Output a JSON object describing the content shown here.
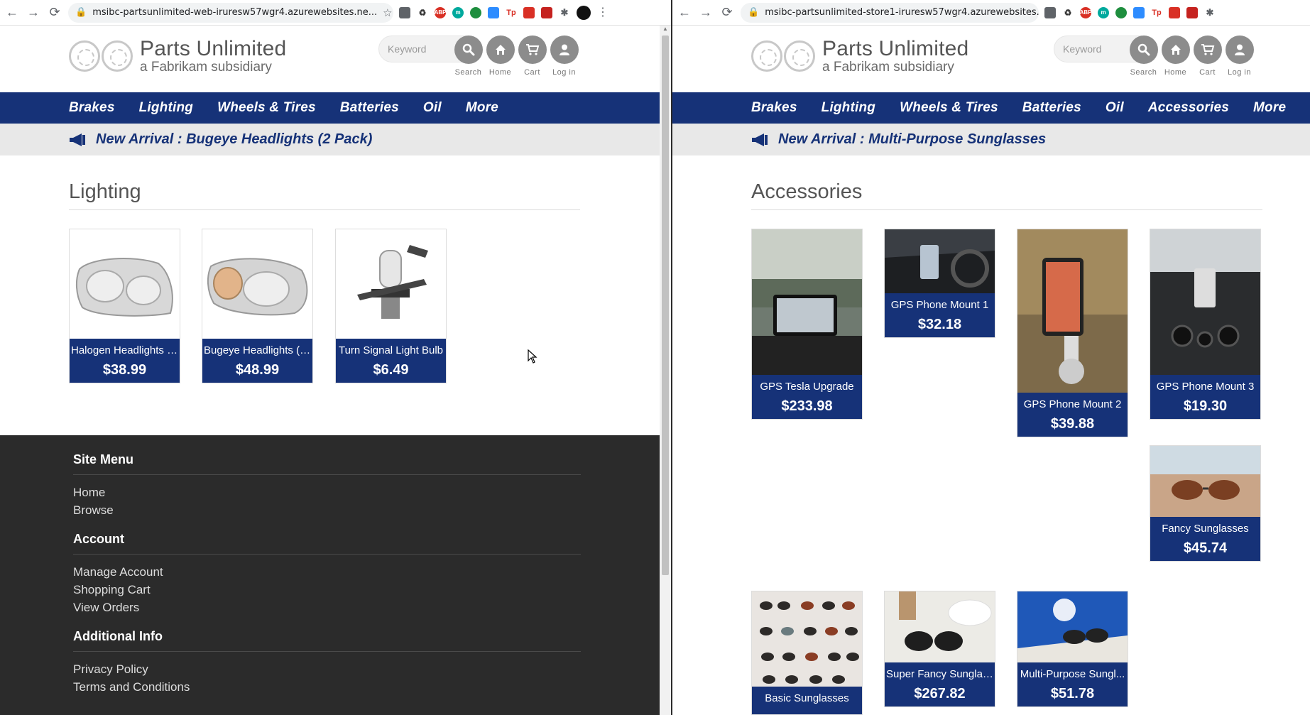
{
  "left": {
    "url": "msibc-partsunlimited-web-iruresw57wgr4.azurewebsites.ne...",
    "brand": {
      "title": "Parts Unlimited",
      "subtitle": "a Fabrikam subsidiary"
    },
    "search": {
      "placeholder": "Keyword"
    },
    "tools": {
      "search": "Search",
      "home": "Home",
      "cart": "Cart",
      "login": "Log in"
    },
    "nav": [
      "Brakes",
      "Lighting",
      "Wheels & Tires",
      "Batteries",
      "Oil",
      "More"
    ],
    "banner": "New Arrival : Bugeye Headlights (2 Pack)",
    "category": "Lighting",
    "products": [
      {
        "name": "Halogen Headlights (...",
        "price": "$38.99"
      },
      {
        "name": "Bugeye Headlights (2...",
        "price": "$48.99"
      },
      {
        "name": "Turn Signal Light Bulb",
        "price": "$6.49"
      }
    ],
    "footer": {
      "site_menu": "Site Menu",
      "home": "Home",
      "browse": "Browse",
      "account": "Account",
      "manage": "Manage Account",
      "cart": "Shopping Cart",
      "orders": "View Orders",
      "additional": "Additional Info",
      "privacy": "Privacy Policy",
      "terms": "Terms and Conditions"
    }
  },
  "right": {
    "url": "msibc-partsunlimited-store1-iruresw57wgr4.azurewebsites....",
    "brand": {
      "title": "Parts Unlimited",
      "subtitle": "a Fabrikam subsidiary"
    },
    "search": {
      "placeholder": "Keyword"
    },
    "tools": {
      "search": "Search",
      "home": "Home",
      "cart": "Cart",
      "login": "Log in"
    },
    "nav": [
      "Brakes",
      "Lighting",
      "Wheels & Tires",
      "Batteries",
      "Oil",
      "Accessories",
      "More"
    ],
    "banner": "New Arrival : Multi-Purpose Sunglasses",
    "category": "Accessories",
    "products": [
      {
        "name": "GPS Tesla Upgrade",
        "price": "$233.98"
      },
      {
        "name": "GPS Phone Mount 1",
        "price": "$32.18"
      },
      {
        "name": "GPS Phone Mount 2",
        "price": "$39.88"
      },
      {
        "name": "GPS Phone Mount 3",
        "price": "$19.30"
      },
      {
        "name": "Fancy Sunglasses",
        "price": "$45.74"
      },
      {
        "name": "Basic Sunglasses",
        "price": ""
      },
      {
        "name": "Super Fancy Sunglass...",
        "price": "$267.82"
      },
      {
        "name": "Multi-Purpose Sungl...",
        "price": "$51.78"
      }
    ]
  },
  "icons": {
    "megaphone": "megaphone-icon",
    "search": "search-icon",
    "home": "home-icon",
    "cart": "cart-icon",
    "user": "user-icon"
  },
  "colors": {
    "navy": "#163278",
    "footer": "#2b2b2b",
    "banner": "#e8e8e8",
    "tool_gray": "#8c8c8c"
  }
}
